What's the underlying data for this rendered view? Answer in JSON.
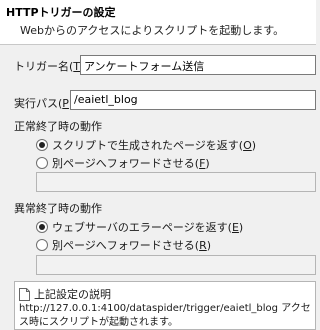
{
  "header": {
    "title": "HTTPトリガーの設定",
    "description": "Webからのアクセスによりスクリプトを起動します。"
  },
  "trigger_name": {
    "label_pre": "トリガー名(",
    "label_key": "T",
    "label_post": "):",
    "value": "アンケートフォーム送信"
  },
  "exec_path": {
    "label_pre": "実行パス(",
    "label_key": "P",
    "label_post": "):",
    "value": "/eaietl_blog"
  },
  "normal_exit": {
    "title": "正常終了時の動作",
    "option1_pre": "スクリプトで生成されたページを返す(",
    "option1_key": "O",
    "option1_post": ")",
    "option1_checked": true,
    "option2_pre": "別ページへフォワードさせる(",
    "option2_key": "F",
    "option2_post": ")",
    "option2_checked": false,
    "forward_value": ""
  },
  "abnormal_exit": {
    "title": "異常終了時の動作",
    "option1_pre": "ウェブサーバのエラーページを返す(",
    "option1_key": "E",
    "option1_post": ")",
    "option1_checked": true,
    "option2_pre": "別ページへフォワードさせる(",
    "option2_key": "R",
    "option2_post": ")",
    "option2_checked": false,
    "forward_value": ""
  },
  "help": {
    "title": "上記設定の説明",
    "body": "http://127.0.0.1:4100/dataspider/trigger/eaietl_blog アクセス時にスクリプトが起動されます。"
  }
}
